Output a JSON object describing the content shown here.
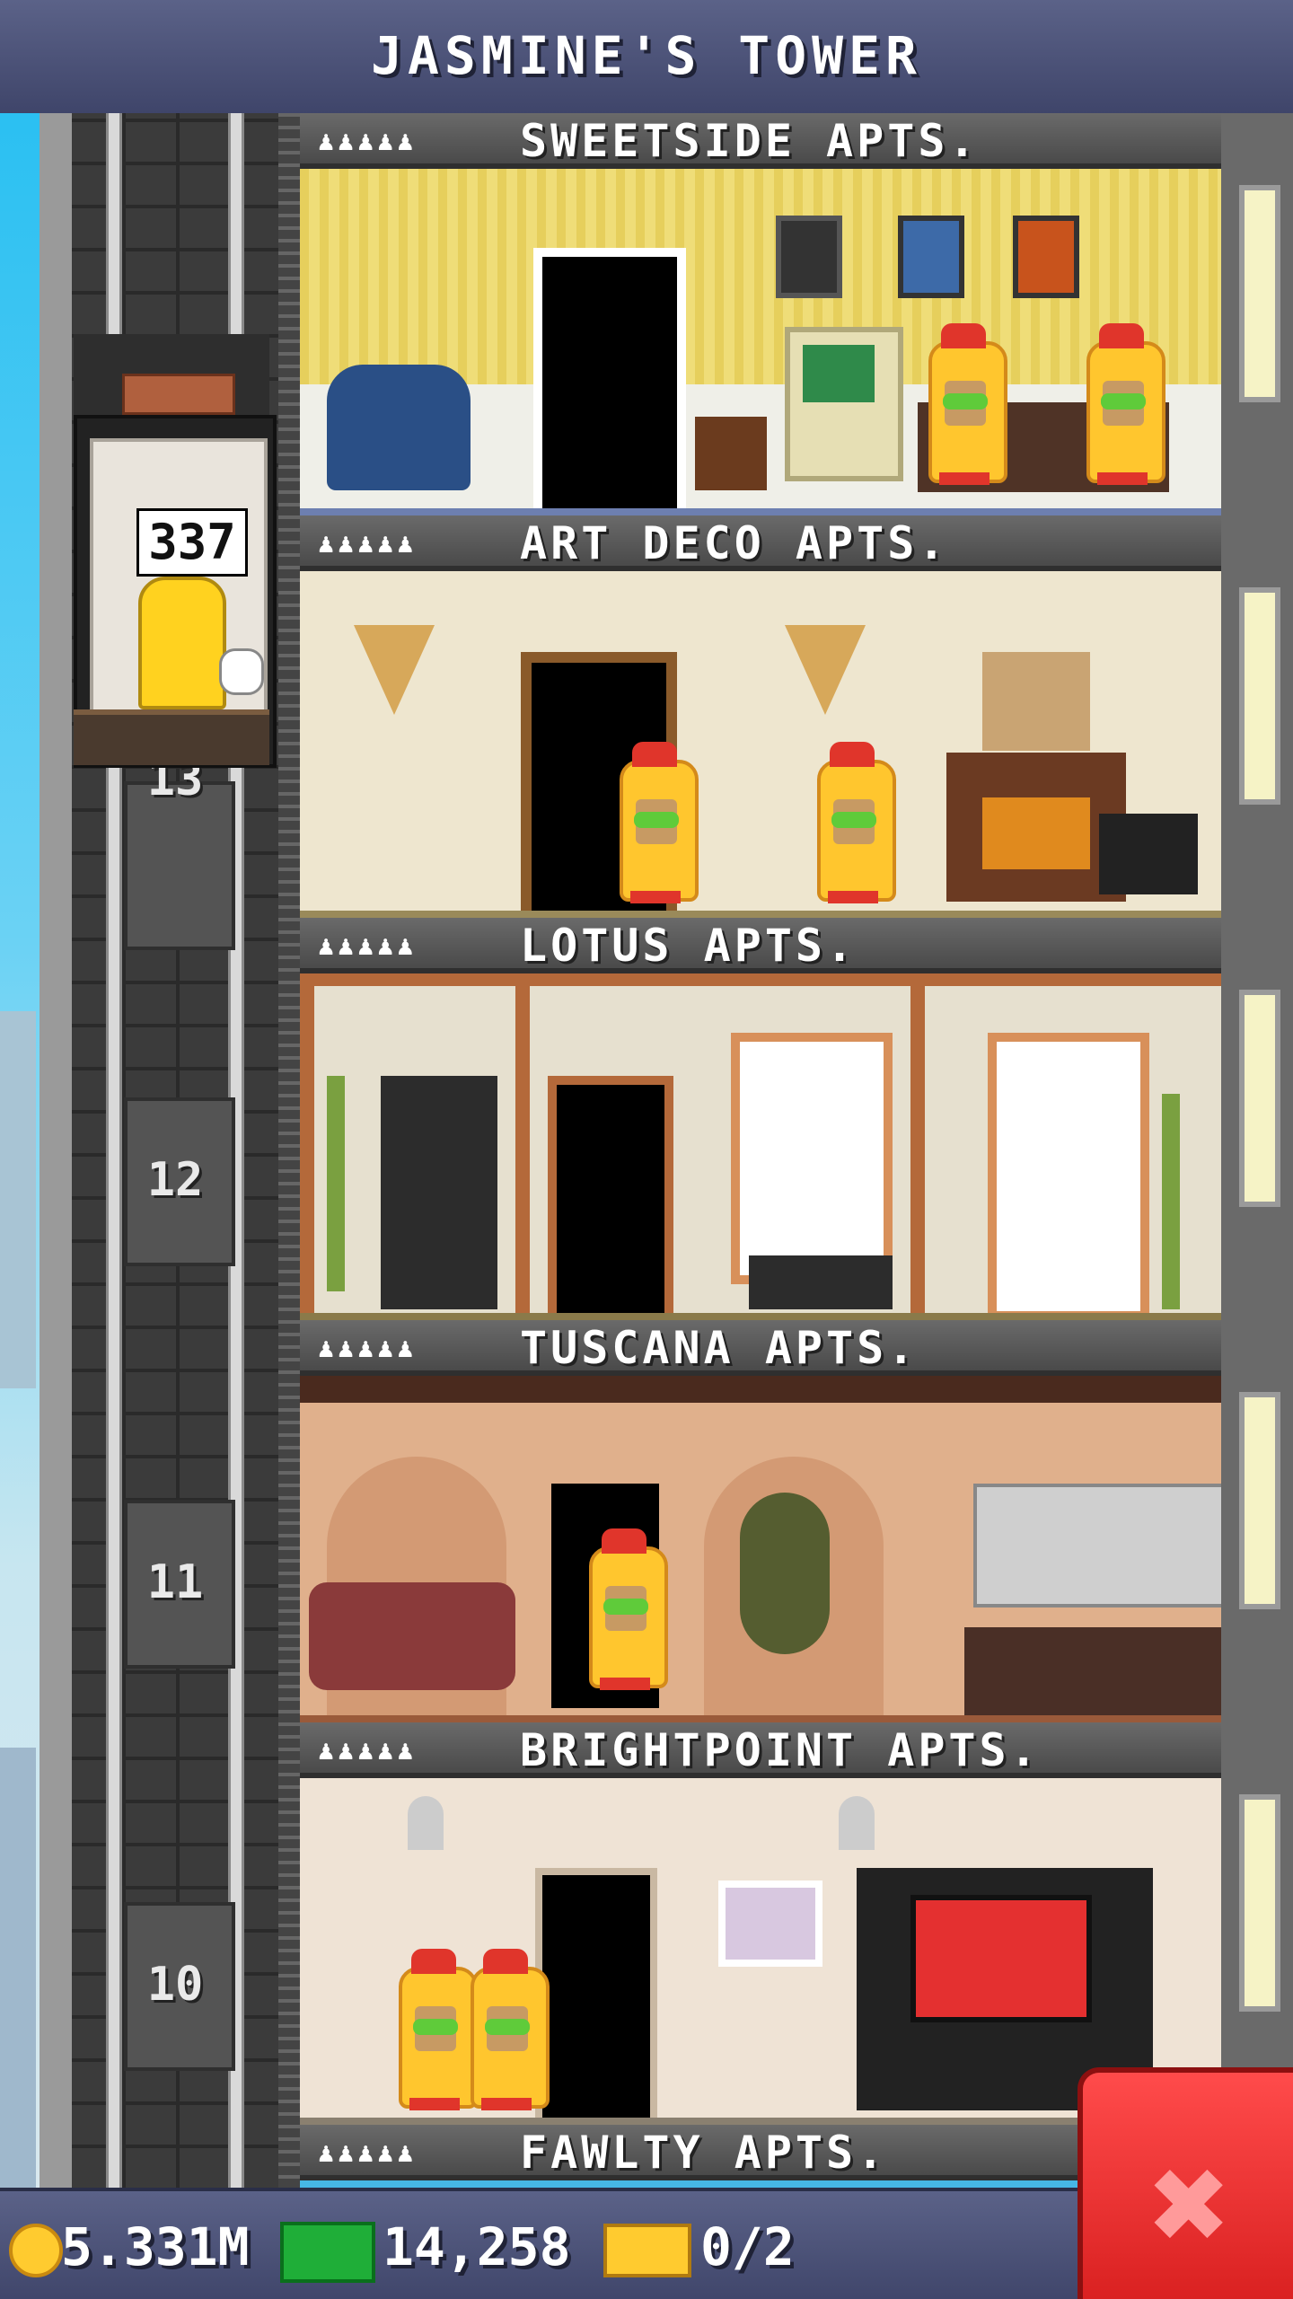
{
  "app": {
    "title": "JASMINE'S TOWER"
  },
  "elevator": {
    "counter": "337",
    "floor_labels": [
      "13",
      "12",
      "11",
      "10"
    ]
  },
  "floors": [
    {
      "name": "SWEETSIDE APTS.",
      "people_icons": "♟♟♟♟♟"
    },
    {
      "name": "ART DECO APTS.",
      "people_icons": "♟♟♟♟♟"
    },
    {
      "name": "LOTUS APTS.",
      "people_icons": "♟♟♟♟♟"
    },
    {
      "name": "TUSCANA APTS.",
      "people_icons": "♟♟♟♟♟"
    },
    {
      "name": "BRIGHTPOINT APTS.",
      "people_icons": "♟♟♟♟♟"
    },
    {
      "name": "FAWLTY APTS.",
      "people_icons": "♟♟♟♟♟"
    }
  ],
  "status": {
    "coins": "5.331M",
    "bux": "14,258",
    "tickets": "0/2"
  },
  "colors": {
    "bar": "#4a5078",
    "close": "#e32b2b"
  },
  "icons": {
    "coins": "coin-icon",
    "bux": "tower-bux-icon",
    "tickets": "ticket-icon",
    "close": "close-icon"
  }
}
